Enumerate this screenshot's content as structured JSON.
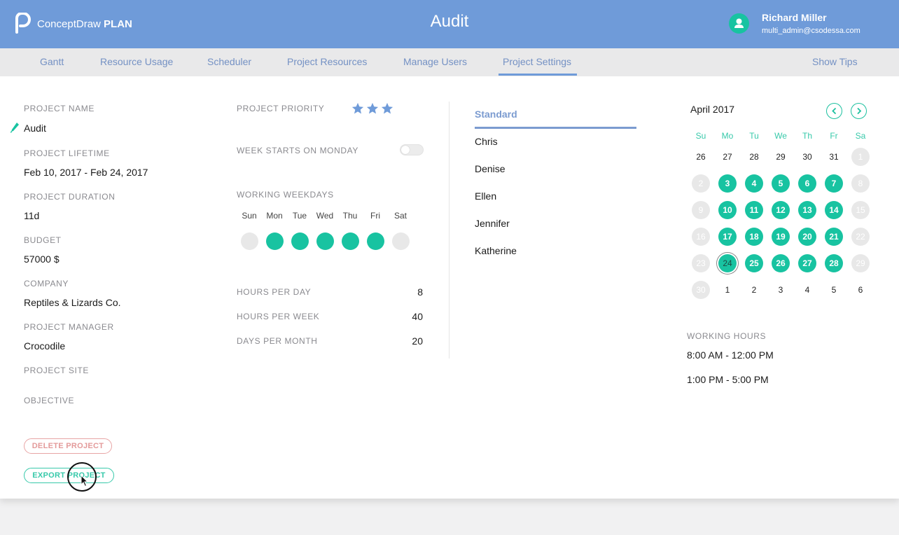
{
  "header": {
    "brand_prefix": "ConceptDraw",
    "brand_suffix": "PLAN",
    "title": "Audit",
    "user_name": "Richard Miller",
    "user_email": "multi_admin@csodessa.com"
  },
  "nav": {
    "tabs": [
      "Gantt",
      "Resource Usage",
      "Scheduler",
      "Project Resources",
      "Manage Users",
      "Project Settings"
    ],
    "active_tab": "Project Settings",
    "show_tips": "Show Tips"
  },
  "project": {
    "name_label": "PROJECT NAME",
    "name": "Audit",
    "lifetime_label": "PROJECT LIFETIME",
    "lifetime": "Feb 10, 2017 - Feb 24, 2017",
    "duration_label": "PROJECT DURATION",
    "duration": "11d",
    "budget_label": "BUDGET",
    "budget": "57000 $",
    "company_label": "COMPANY",
    "company": "Reptiles & Lizards Co.",
    "manager_label": "PROJECT MANAGER",
    "manager": "Crocodile",
    "site_label": "PROJECT SITE",
    "objective_label": "OBJECTIVE",
    "delete_button": "DELETE PROJECT",
    "export_button": "EXPORT PROJECT"
  },
  "settings": {
    "priority_label": "PROJECT PRIORITY",
    "priority_stars": 3,
    "week_starts_label": "WEEK STARTS ON MONDAY",
    "week_starts_monday": false,
    "weekdays_label": "WORKING WEEKDAYS",
    "weekdays": [
      {
        "name": "Sun",
        "working": false
      },
      {
        "name": "Mon",
        "working": true
      },
      {
        "name": "Tue",
        "working": true
      },
      {
        "name": "Wed",
        "working": true
      },
      {
        "name": "Thu",
        "working": true
      },
      {
        "name": "Fri",
        "working": true
      },
      {
        "name": "Sat",
        "working": false
      }
    ],
    "hours_per_day_label": "HOURS PER DAY",
    "hours_per_day": "8",
    "hours_per_week_label": "HOURS PER WEEK",
    "hours_per_week": "40",
    "days_per_month_label": "DAYS PER MONTH",
    "days_per_month": "20"
  },
  "calendars": {
    "standard": "Standard",
    "resources": [
      "Chris",
      "Denise",
      "Ellen",
      "Jennifer",
      "Katherine"
    ]
  },
  "month_calendar": {
    "month": "April",
    "year": "2017",
    "dow": [
      "Su",
      "Mo",
      "Tu",
      "We",
      "Th",
      "Fr",
      "Sa"
    ],
    "rows": [
      [
        {
          "d": "26",
          "t": "plain"
        },
        {
          "d": "27",
          "t": "plain"
        },
        {
          "d": "28",
          "t": "plain"
        },
        {
          "d": "29",
          "t": "plain"
        },
        {
          "d": "30",
          "t": "plain"
        },
        {
          "d": "31",
          "t": "plain"
        },
        {
          "d": "1",
          "t": "off"
        }
      ],
      [
        {
          "d": "2",
          "t": "off"
        },
        {
          "d": "3",
          "t": "work"
        },
        {
          "d": "4",
          "t": "work"
        },
        {
          "d": "5",
          "t": "work"
        },
        {
          "d": "6",
          "t": "work"
        },
        {
          "d": "7",
          "t": "work"
        },
        {
          "d": "8",
          "t": "off"
        }
      ],
      [
        {
          "d": "9",
          "t": "off"
        },
        {
          "d": "10",
          "t": "work"
        },
        {
          "d": "11",
          "t": "work"
        },
        {
          "d": "12",
          "t": "work"
        },
        {
          "d": "13",
          "t": "work"
        },
        {
          "d": "14",
          "t": "work"
        },
        {
          "d": "15",
          "t": "off"
        }
      ],
      [
        {
          "d": "16",
          "t": "off"
        },
        {
          "d": "17",
          "t": "work"
        },
        {
          "d": "18",
          "t": "work"
        },
        {
          "d": "19",
          "t": "work"
        },
        {
          "d": "20",
          "t": "work"
        },
        {
          "d": "21",
          "t": "work"
        },
        {
          "d": "22",
          "t": "off"
        }
      ],
      [
        {
          "d": "23",
          "t": "off"
        },
        {
          "d": "24",
          "t": "today"
        },
        {
          "d": "25",
          "t": "work"
        },
        {
          "d": "26",
          "t": "work"
        },
        {
          "d": "27",
          "t": "work"
        },
        {
          "d": "28",
          "t": "work"
        },
        {
          "d": "29",
          "t": "off"
        }
      ],
      [
        {
          "d": "30",
          "t": "off"
        },
        {
          "d": "1",
          "t": "plain"
        },
        {
          "d": "2",
          "t": "plain"
        },
        {
          "d": "3",
          "t": "plain"
        },
        {
          "d": "4",
          "t": "plain"
        },
        {
          "d": "5",
          "t": "plain"
        },
        {
          "d": "6",
          "t": "plain"
        }
      ]
    ],
    "working_hours_label": "WORKING HOURS",
    "working_hours": [
      "8:00 AM - 12:00 PM",
      "1:00 PM - 5:00 PM"
    ]
  },
  "colors": {
    "header": "#6f9bd9",
    "accent": "#18c3a1",
    "tab_text": "#7491c4",
    "off_day": "#e8e8e8",
    "star": "#6f9bd9"
  },
  "icons": [
    "logo-icon",
    "user-icon",
    "pencil-icon",
    "star-icon",
    "chevron-left-icon",
    "chevron-right-icon",
    "cursor-icon"
  ]
}
